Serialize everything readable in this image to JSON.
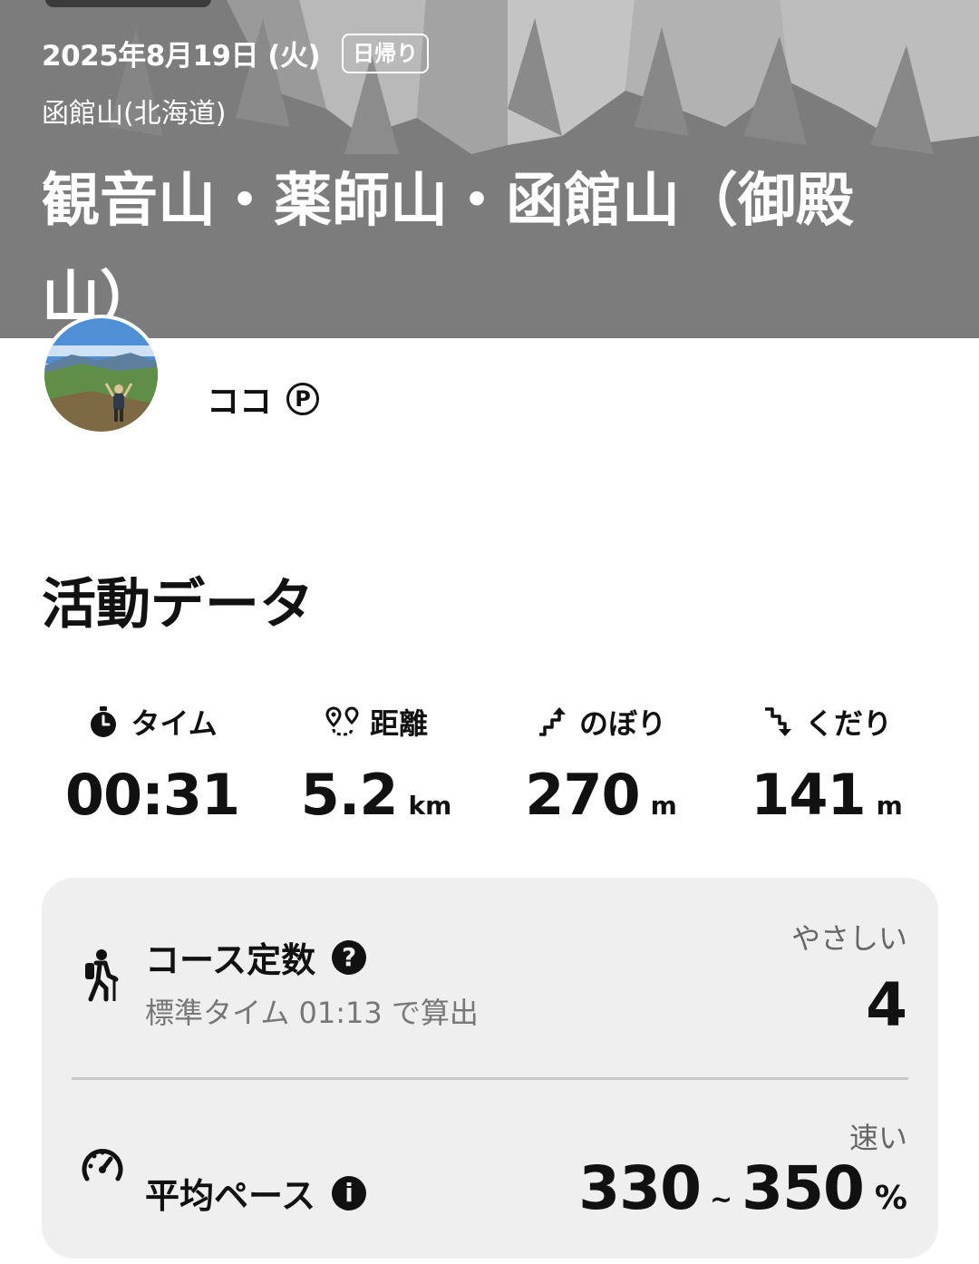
{
  "header": {
    "date": "2025年8月19日 (火)",
    "trip_type": "日帰り",
    "area": "函館山(北海道)",
    "title": "観音山・薬師山・函館山（御殿山）"
  },
  "user": {
    "name": "ココ",
    "premium_badge": "P",
    "avatar_icon": "profile-photo"
  },
  "activity": {
    "section_title": "活動データ",
    "stats": [
      {
        "icon": "stopwatch-icon",
        "label": "タイム",
        "value": "00:31",
        "unit": ""
      },
      {
        "icon": "route-pin-icon",
        "label": "距離",
        "value": "5.2",
        "unit": "km"
      },
      {
        "icon": "ascent-icon",
        "label": "のぼり",
        "value": "270",
        "unit": "m"
      },
      {
        "icon": "descent-icon",
        "label": "くだり",
        "value": "141",
        "unit": "m"
      }
    ]
  },
  "course_constant": {
    "icon": "hiker-icon",
    "title": "コース定数",
    "help_icon": "?",
    "subtitle": "標準タイム 01:13 で算出",
    "rating": "やさしい",
    "value": "4"
  },
  "average_pace": {
    "icon": "speedometer-icon",
    "title": "平均ペース",
    "info_icon": "i",
    "rating": "速い",
    "min": "330",
    "separator": "~",
    "max": "350",
    "unit": "%"
  },
  "colors": {
    "header_bg": "#7f7f7f",
    "card_bg": "#efefef",
    "text": "#111111",
    "muted_text": "#777777"
  }
}
